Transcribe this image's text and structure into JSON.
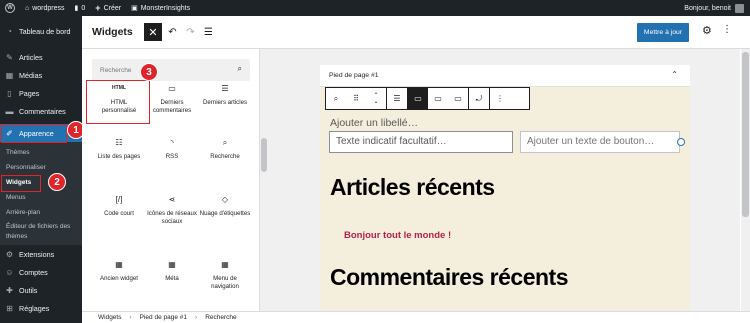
{
  "admin_bar": {
    "site_name": "wordpress",
    "comments_count": "0",
    "new_label": "Créer",
    "plugin_label": "MonsterInsights",
    "greeting": "Bonjour, benoit"
  },
  "sidebar": {
    "items_top": [
      {
        "label": "Tableau de bord",
        "icon": "dashboard-icon"
      },
      {
        "label": "Articles",
        "icon": "pin-icon"
      },
      {
        "label": "Médias",
        "icon": "media-icon"
      },
      {
        "label": "Pages",
        "icon": "page-icon"
      },
      {
        "label": "Commentaires",
        "icon": "comment-icon"
      }
    ],
    "active_item": {
      "label": "Apparence",
      "icon": "brush-icon"
    },
    "submenu": [
      "Thèmes",
      "Personnaliser",
      "Widgets",
      "Menus",
      "Arrière-plan",
      "Éditeur de fichiers des thèmes"
    ],
    "items_bottom": [
      {
        "label": "Extensions",
        "icon": "plugin-icon"
      },
      {
        "label": "Comptes",
        "icon": "users-icon"
      },
      {
        "label": "Outils",
        "icon": "tools-icon"
      },
      {
        "label": "Réglages",
        "icon": "settings-icon"
      }
    ]
  },
  "callouts": [
    "1",
    "2",
    "3"
  ],
  "editor_header": {
    "title": "Widgets",
    "update_button": "Mettre à jour"
  },
  "inserter": {
    "search_placeholder": "Recherche",
    "blocks": [
      {
        "label": "HTML personnalisé",
        "icon": "html-icon"
      },
      {
        "label": "Derniers commentaires",
        "icon": "comment-icon"
      },
      {
        "label": "Derniers articles",
        "icon": "list-icon"
      },
      {
        "label": "Liste des pages",
        "icon": "page-list-icon"
      },
      {
        "label": "RSS",
        "icon": "rss-icon"
      },
      {
        "label": "Recherche",
        "icon": "search-icon"
      },
      {
        "label": "Code court",
        "icon": "shortcode-icon"
      },
      {
        "label": "Icônes de réseaux sociaux",
        "icon": "share-icon"
      },
      {
        "label": "Nuage d'étiquettes",
        "icon": "tag-icon"
      },
      {
        "label": "Ancien widget",
        "icon": "calendar-icon"
      },
      {
        "label": "Méta",
        "icon": "calendar-icon"
      },
      {
        "label": "Menu de navigation",
        "icon": "calendar-icon"
      }
    ]
  },
  "canvas": {
    "area_title": "Pied de page #1",
    "label_placeholder": "Ajouter un libellé…",
    "input_placeholder": "Texte indicatif facultatif…",
    "button_placeholder": "Ajouter un texte de bouton…",
    "heading_articles": "Articles récents",
    "post_link": "Bonjour tout le monde !",
    "heading_comments": "Commentaires récents"
  },
  "breadcrumb": [
    "Widgets",
    "Pied de page #1",
    "Recherche"
  ],
  "colors": {
    "admin_dark": "#1d2327",
    "accent_blue": "#2271b1",
    "callout_red": "#e0242c",
    "footer_bg": "#f4eedd",
    "link_color": "#b3224c"
  }
}
